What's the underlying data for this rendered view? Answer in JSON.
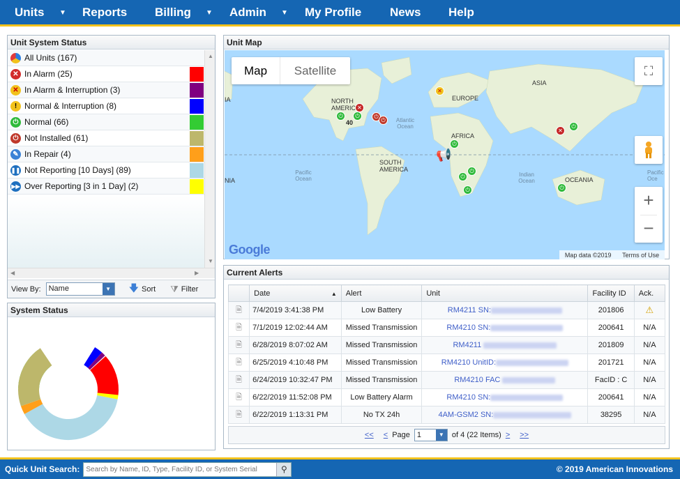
{
  "nav": {
    "items": [
      {
        "label": "Units",
        "dropdown": true
      },
      {
        "label": "Reports",
        "dropdown": false
      },
      {
        "label": "Billing",
        "dropdown": true
      },
      {
        "label": "Admin",
        "dropdown": true
      },
      {
        "label": "My Profile",
        "dropdown": false
      },
      {
        "label": "News",
        "dropdown": false
      },
      {
        "label": "Help",
        "dropdown": false
      }
    ]
  },
  "unit_status": {
    "title": "Unit System Status",
    "rows": [
      {
        "label": "All Units (167)",
        "icon": "all-units-icon",
        "color": ""
      },
      {
        "label": "In Alarm (25)",
        "icon": "alarm-x-icon",
        "color": "#ff0000"
      },
      {
        "label": "In Alarm & Interruption (3)",
        "icon": "alarm-interruption-icon",
        "color": "#800080"
      },
      {
        "label": "Normal & Interruption (8)",
        "icon": "exclamation-icon",
        "color": "#0000ff"
      },
      {
        "label": "Normal (66)",
        "icon": "power-normal-icon",
        "color": "#33cc33"
      },
      {
        "label": "Not Installed (61)",
        "icon": "power-not-installed-icon",
        "color": "#bdb76b"
      },
      {
        "label": "In Repair (4)",
        "icon": "wrench-icon",
        "color": "#ff9f1a"
      },
      {
        "label": "Not Reporting [10 Days] (89)",
        "icon": "pause-icon",
        "color": "#add8e6"
      },
      {
        "label": "Over Reporting [3 in 1 Day] (2)",
        "icon": "fast-forward-icon",
        "color": "#ffff00"
      }
    ],
    "view_by_label": "View By:",
    "view_by_value": "Name",
    "sort_label": "Sort",
    "filter_label": "Filter"
  },
  "system_status": {
    "title": "System Status"
  },
  "unit_map": {
    "title": "Unit Map",
    "map_tab": "Map",
    "satellite_tab": "Satellite",
    "labels": {
      "asia": "ASIA",
      "europe": "EUROPE",
      "north_america": "NORTH AMERICA",
      "africa": "AFRICA",
      "south_america": "SOUTH AMERICA",
      "oceania": "OCEANIA",
      "atlantic": "Atlantic Ocean",
      "pacific_left": "Pacific Ocean",
      "pacific_right": "Pacific Oce",
      "indian": "Indian Ocean",
      "cluster": "40",
      "left_edge": "IA",
      "left_edge_2": "NIA"
    },
    "google": "Google",
    "attribution": "Map data ©2019",
    "terms": "Terms of Use"
  },
  "alerts": {
    "title": "Current Alerts",
    "columns": [
      "Date",
      "Alert",
      "Unit",
      "Facility ID",
      "Ack."
    ],
    "rows": [
      {
        "date": "7/4/2019 3:41:38 PM",
        "alert": "Low Battery",
        "unit": "RM4211 SN:",
        "facility": "201806",
        "ack": "",
        "ack_icon": "warning-icon"
      },
      {
        "date": "7/1/2019 12:02:44 AM",
        "alert": "Missed Transmission",
        "unit": "RM4210 SN:",
        "facility": "200641",
        "ack": "N/A"
      },
      {
        "date": "6/28/2019 8:07:02 AM",
        "alert": "Missed Transmission",
        "unit": "RM4211",
        "facility": "201809",
        "ack": "N/A"
      },
      {
        "date": "6/25/2019 4:10:48 PM",
        "alert": "Missed Transmission",
        "unit": "RM4210 UnitID:",
        "facility": "201721",
        "ack": "N/A"
      },
      {
        "date": "6/24/2019 10:32:47 PM",
        "alert": "Missed Transmission",
        "unit": "RM4210 FAC",
        "facility": "FacID : C",
        "ack": "N/A"
      },
      {
        "date": "6/22/2019 11:52:08 PM",
        "alert": "Low Battery Alarm",
        "unit": "RM4210 SN:",
        "facility": "200641",
        "ack": "N/A"
      },
      {
        "date": "6/22/2019 1:13:31 PM",
        "alert": "No TX 24h",
        "unit": "4AM-GSM2 SN:",
        "facility": "38295",
        "ack": "N/A"
      }
    ],
    "pager": {
      "first": "<<",
      "prev": "<",
      "page_label": "Page",
      "page_value": "1",
      "of_label": "of 4 (22 Items)",
      "next": ">",
      "last": ">>"
    }
  },
  "footer": {
    "search_label": "Quick Unit Search:",
    "search_placeholder": "Search by Name, ID, Type, Facility ID, or System Serial",
    "copyright": "© 2019 American Innovations"
  },
  "colors": {
    "nav_bg": "#1566b3",
    "accent": "#f2c21b",
    "link": "#3e5ec8"
  }
}
